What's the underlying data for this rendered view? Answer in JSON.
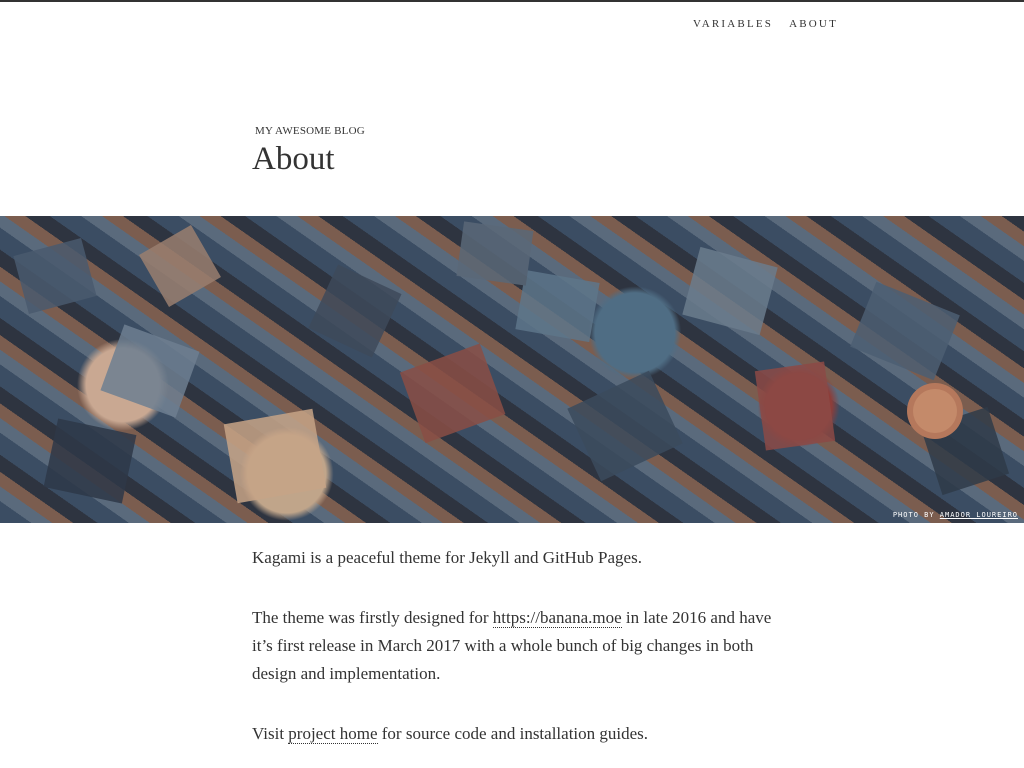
{
  "nav": {
    "items": [
      {
        "label": "VARIABLES"
      },
      {
        "label": "ABOUT"
      }
    ]
  },
  "header": {
    "blog_name": "MY AWESOME BLOG",
    "page_title": "About"
  },
  "hero": {
    "credit_prefix": "PHOTO BY ",
    "credit_name": "AMADOR LOUREIRO"
  },
  "content": {
    "p1": "Kagami is a peaceful theme for Jekyll and GitHub Pages.",
    "p2_before": "The theme was firstly designed for ",
    "p2_link": "https://banana.moe",
    "p2_after": " in late 2016 and have it’s first release in March 2017 with a whole bunch of big changes in both design and implementation.",
    "p3_before": "Visit ",
    "p3_link": "project home",
    "p3_after": " for source code and installation guides."
  },
  "colors": {
    "text": "#333333",
    "background": "#ffffff",
    "top_border": "#333333"
  }
}
